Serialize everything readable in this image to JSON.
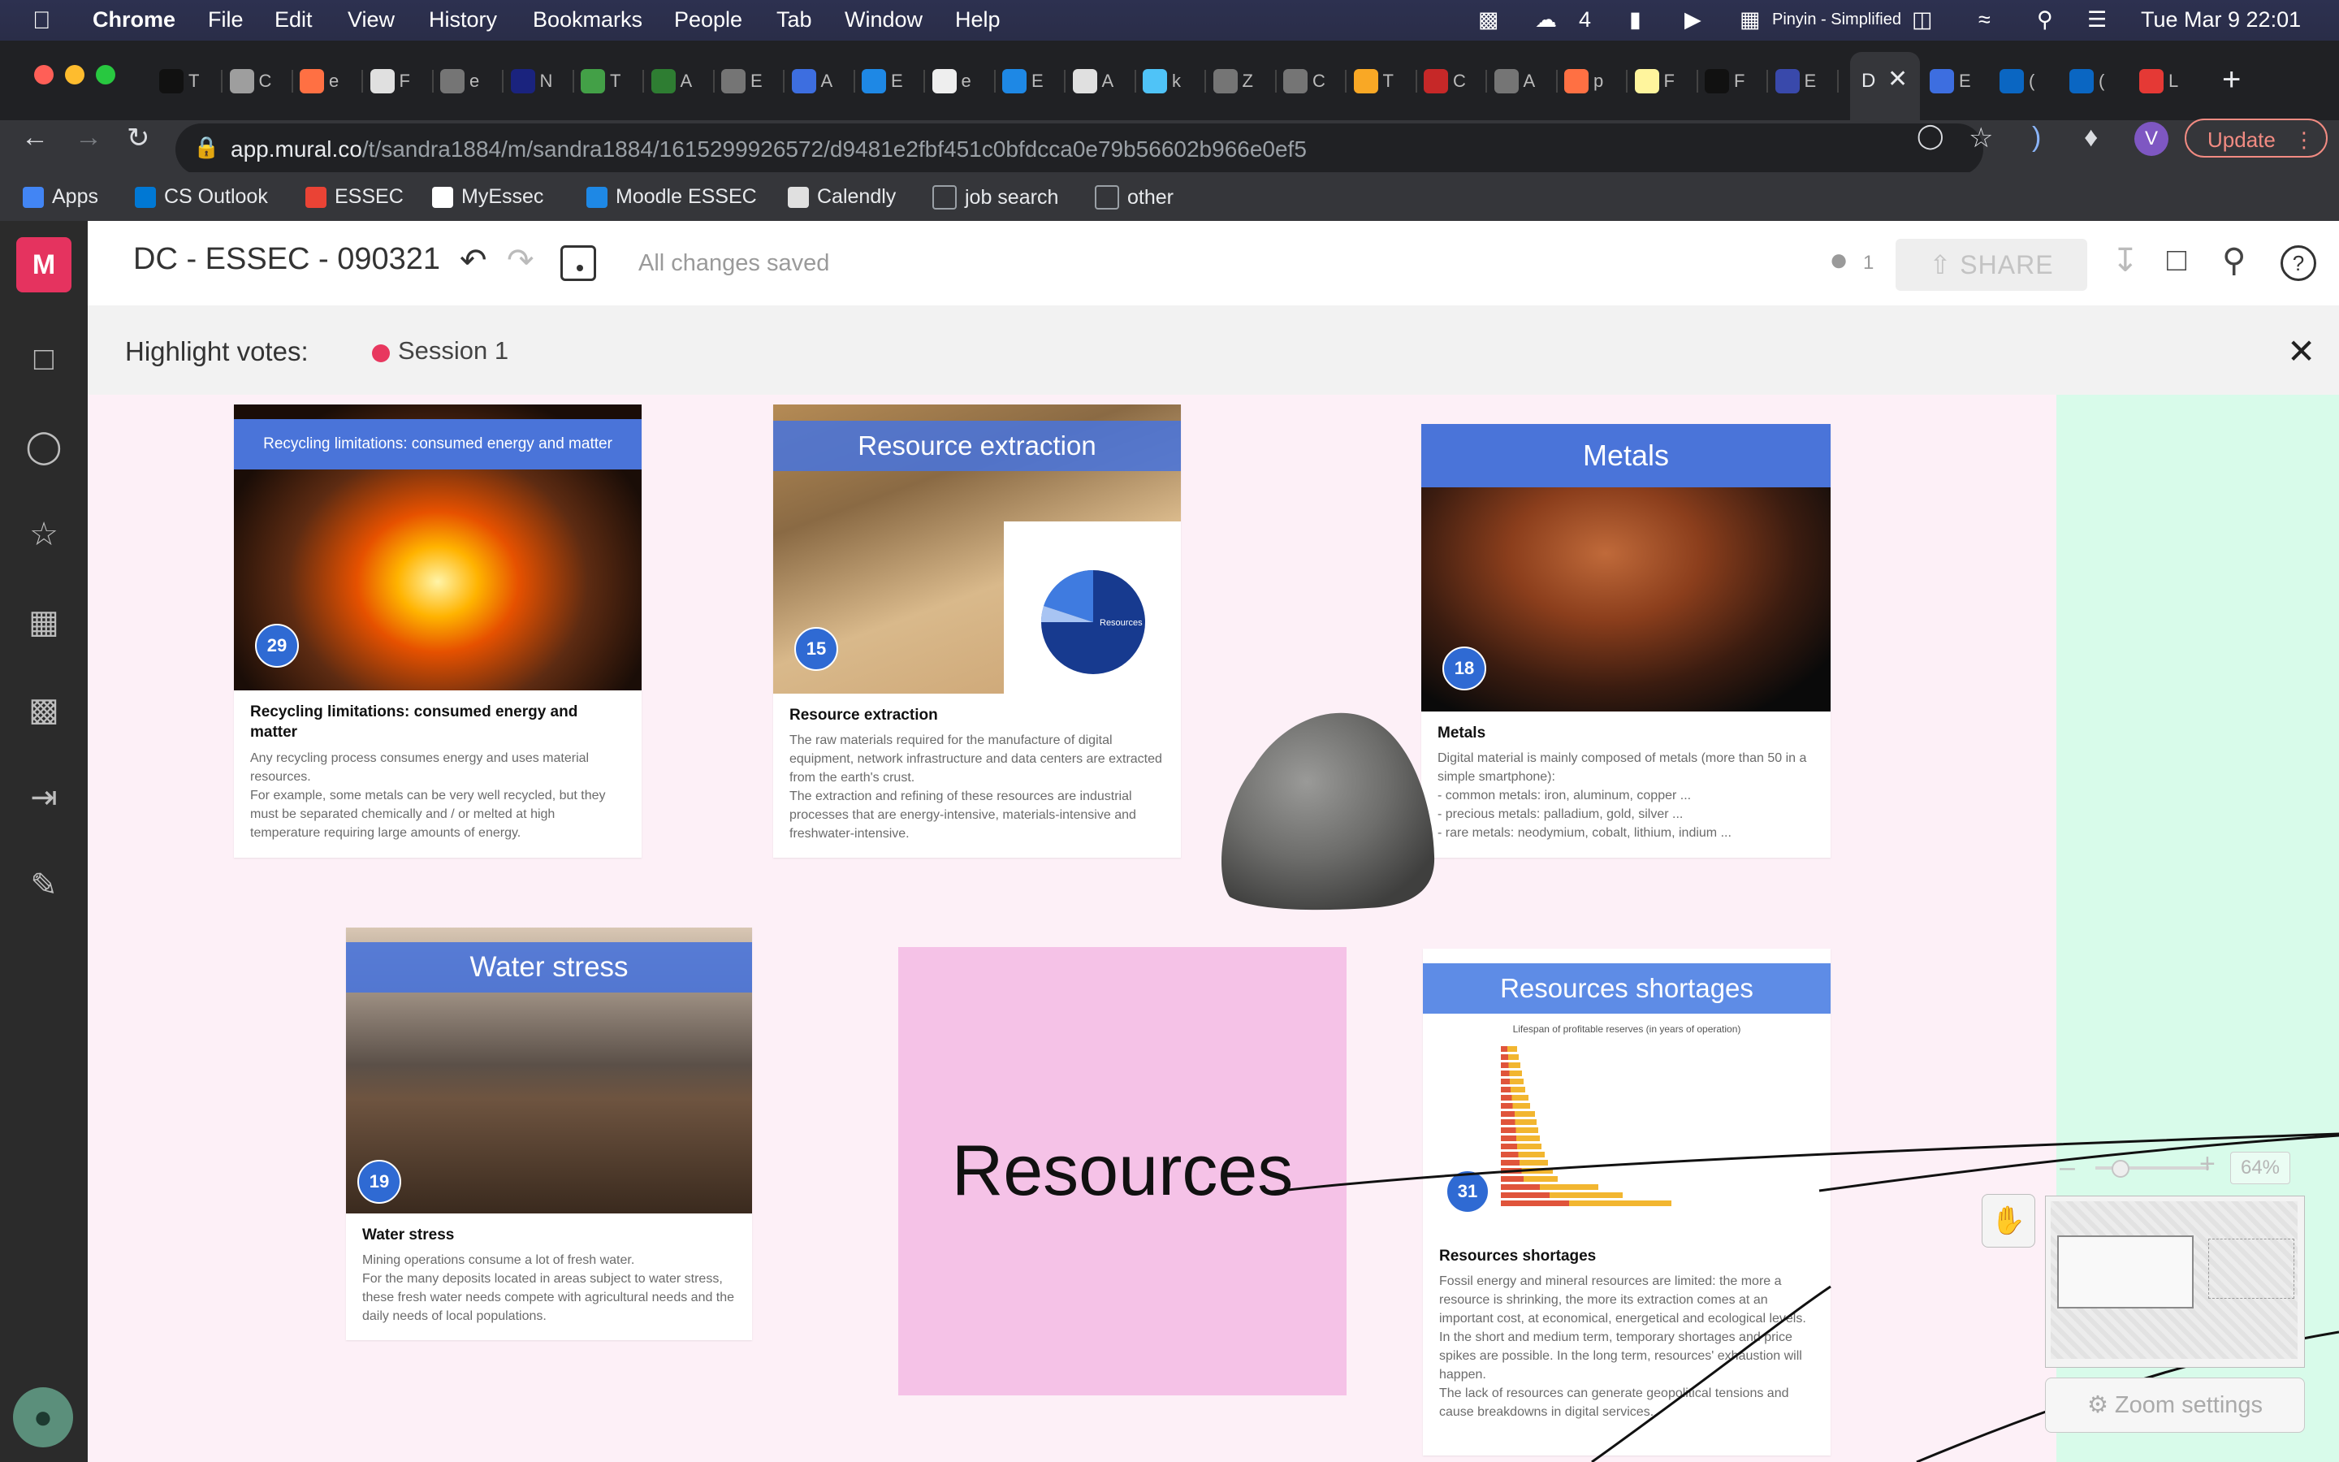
{
  "menubar": {
    "app": "Chrome",
    "menus": [
      "File",
      "Edit",
      "View",
      "History",
      "Bookmarks",
      "People",
      "Tab",
      "Window",
      "Help"
    ],
    "status": {
      "wechat_count": "4",
      "input_method": "Pinyin - Simplified",
      "datetime": "Tue Mar 9  22:01"
    }
  },
  "tabs": [
    {
      "letter": "T",
      "color": "#111111"
    },
    {
      "letter": "C",
      "color": "#9e9e9e"
    },
    {
      "letter": "e",
      "color": "#ff7043"
    },
    {
      "letter": "F",
      "color": "#e0e0e0"
    },
    {
      "letter": "e",
      "color": "#757575"
    },
    {
      "letter": "N",
      "color": "#1a237e"
    },
    {
      "letter": "T",
      "color": "#43a047"
    },
    {
      "letter": "A",
      "color": "#2e7d32"
    },
    {
      "letter": "E",
      "color": "#757575"
    },
    {
      "letter": "A",
      "color": "#3d6ee0"
    },
    {
      "letter": "E",
      "color": "#1e88e5"
    },
    {
      "letter": "e",
      "color": "#eeeeee"
    },
    {
      "letter": "E",
      "color": "#1e88e5"
    },
    {
      "letter": "A",
      "color": "#e0e0e0"
    },
    {
      "letter": "k",
      "color": "#4fc3f7"
    },
    {
      "letter": "Z",
      "color": "#757575"
    },
    {
      "letter": "C",
      "color": "#757575"
    },
    {
      "letter": "T",
      "color": "#f9a825"
    },
    {
      "letter": "C",
      "color": "#c62828"
    },
    {
      "letter": "A",
      "color": "#757575"
    },
    {
      "letter": "p",
      "color": "#ff7043"
    },
    {
      "letter": "F",
      "color": "#fff59d"
    },
    {
      "letter": "F",
      "color": "#111111"
    },
    {
      "letter": "E",
      "color": "#3949ab"
    }
  ],
  "active_tab": {
    "label": "D"
  },
  "tabs_after": [
    {
      "letter": "E",
      "color": "#3d6ee0"
    },
    {
      "letter": "(",
      "color": "#0a66c2"
    },
    {
      "letter": "(",
      "color": "#0a66c2"
    },
    {
      "letter": "L",
      "color": "#e53935"
    }
  ],
  "address": {
    "host": "app.mural.co",
    "path": "/t/sandra1884/m/sandra1884/1615299926572/d9481e2fbf451c0bfdcca0e79b56602b966e0ef5"
  },
  "profile_initial": "V",
  "update_label": "Update",
  "bookmarks": [
    {
      "label": "Apps",
      "color": "#4285f4"
    },
    {
      "label": "CS Outlook",
      "color": "#0078d4"
    },
    {
      "label": "ESSEC",
      "color": "#ea4335"
    },
    {
      "label": "MyEssec",
      "color": "#ffffff"
    },
    {
      "label": "Moodle ESSEC",
      "color": "#1e88e5"
    },
    {
      "label": "Calendly",
      "color": "#e0e0e0"
    },
    {
      "label": "job search",
      "color": "#9aa0a6"
    },
    {
      "label": "other",
      "color": "#9aa0a6"
    }
  ],
  "mural": {
    "logo": "M",
    "title": "DC - ESSEC - 090321",
    "saved_status": "All changes saved",
    "collaborators": "1",
    "share_label": "SHARE",
    "highlight_label": "Highlight votes:",
    "session_label": "Session 1"
  },
  "cards": {
    "recycling": {
      "banner": "Recycling limitations: consumed energy and matter",
      "number": "29",
      "title": "Recycling limitations: consumed energy and matter",
      "body": "Any recycling process consumes energy and uses material resources.\nFor example, some metals can be very well recycled, but they must be separated chemically and / or melted at high temperature requiring large amounts of energy."
    },
    "extraction": {
      "banner": "Resource extraction",
      "number": "15",
      "title": "Resource extraction",
      "body": "The raw materials required for the manufacture of digital equipment, network infrastructure and data centers are extracted from the earth's crust.\nThe extraction and refining of these resources are industrial processes that are energy-intensive, materials-intensive and freshwater-intensive.",
      "pie_caption": "Resources",
      "pie_values": [
        76,
        16,
        8
      ]
    },
    "metals": {
      "banner": "Metals",
      "number": "18",
      "title": "Metals",
      "body": "Digital material is mainly composed of metals (more than 50 in a simple smartphone):\n- common metals: iron, aluminum, copper ...\n- precious metals: palladium, gold, silver ...\n- rare metals: neodymium, cobalt, lithium, indium ..."
    },
    "water": {
      "banner": "Water stress",
      "number": "19",
      "title": "Water stress",
      "body": "Mining operations consume a lot of fresh water.\nFor the many deposits located in areas subject to water stress, these fresh water needs compete with agricultural needs and the daily needs of local populations."
    },
    "shortages": {
      "banner": "Resources shortages",
      "number": "31",
      "chart_title": "Lifespan of profitable reserves (in years of operation)",
      "title": "Resources shortages",
      "body": "Fossil energy and mineral resources are limited: the more a resource is shrinking, the more its extraction comes at an important cost, at economical, energetical and ecological levels.\nIn the short and medium term, temporary shortages and price spikes are possible. In the long term, resources' exhaustion will happen.\nThe lack of resources can generate geopolitical tensions and cause breakdowns in digital services."
    }
  },
  "sticky_note": {
    "text": "Resources",
    "color": "#f5c2e7"
  },
  "zoom": {
    "percent": "64%",
    "settings_label": "Zoom settings"
  }
}
